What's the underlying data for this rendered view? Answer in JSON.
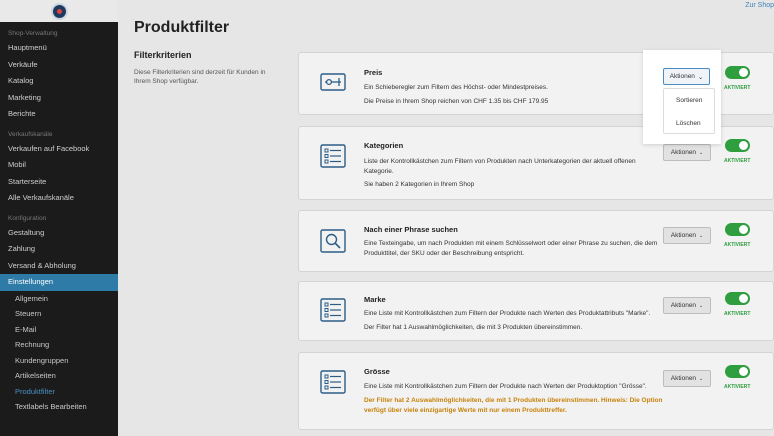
{
  "sidebar": {
    "sections": [
      {
        "header": "Shop-Verwaltung",
        "items": [
          "Hauptmenü",
          "Verkäufe",
          "Katalog",
          "Marketing",
          "Berichte"
        ]
      },
      {
        "header": "Verkaufskanäle",
        "items": [
          "Verkaufen auf Facebook",
          "Mobil",
          "Starterseite",
          "Alle Verkaufskanäle"
        ]
      },
      {
        "header": "Konfiguration",
        "items": [
          "Gestaltung",
          "Zahlung",
          "Versand & Abholung",
          "Einstellungen"
        ]
      }
    ],
    "active_item": "Einstellungen",
    "sub_items": [
      "Allgemein",
      "Steuern",
      "E-Mail",
      "Rechnung",
      "Kundengruppen",
      "Artikelseiten",
      "Produktfilter",
      "Textlabels Bearbeiten"
    ],
    "current_sub_item": "Produktfilter"
  },
  "header": {
    "to_shop_link": "Zur Shop",
    "page_title": "Produktfilter"
  },
  "criteria": {
    "title": "Filterkriterien",
    "description": "Diese Filterkriterien sind derzeit für Kunden in Ihrem Shop verfügbar."
  },
  "actions_label": "Aktionen",
  "toggle_label": "AKTIVIERT",
  "dropdown": {
    "items": [
      "Sortieren",
      "Löschen"
    ]
  },
  "filters": [
    {
      "title": "Preis",
      "description": "Ein Schieberegler zum Filtern des Höchst- oder Mindestpreises.",
      "detail": "Die Preise in Ihrem Shop reichen von CHF 1.35 bis CHF 179.95",
      "icon": "price-slider-icon",
      "enabled": true
    },
    {
      "title": "Kategorien",
      "description": "Liste der Kontrollkästchen zum Filtern von Produkten nach Unterkategorien der aktuell offenen Kategorie.",
      "detail": "Sie haben 2 Kategorien in Ihrem Shop",
      "icon": "checklist-icon",
      "enabled": true
    },
    {
      "title": "Nach einer Phrase suchen",
      "description": "Eine Texteingabe, um nach Produkten mit einem Schlüsselwort oder einer Phrase zu suchen, die dem Produkttitel, der SKU oder der Beschreibung entspricht.",
      "detail": "",
      "icon": "search-icon",
      "enabled": true
    },
    {
      "title": "Marke",
      "description": "Eine Liste mit Kontrollkästchen zum Filtern der Produkte nach Werten des Produktattributs \"Marke\".",
      "detail": "Der Filter hat 1 Auswahlmöglichkeiten, die mit 3 Produkten übereinstimmen.",
      "icon": "checklist-icon",
      "enabled": true
    },
    {
      "title": "Grösse",
      "description": "Eine Liste mit Kontrollkästchen zum Filtern der Produkte nach Werten der Produktoption \"Grösse\".",
      "detail": "",
      "note": "Der Filter hat 2 Auswahlmöglichkeiten, die mit 1 Produkten übereinstimmen. Hinweis: Die Option verfügt über viele einzigartige Werte mit nur einem Produkttreffer.",
      "icon": "checklist-icon",
      "enabled": true
    }
  ],
  "colors": {
    "sidebar_bg": "#1b1b1b",
    "active_nav": "#2e7ba8",
    "toggle_on": "#2e9e3f",
    "warning_text": "#c8820a",
    "icon_blue": "#2c5d87"
  }
}
